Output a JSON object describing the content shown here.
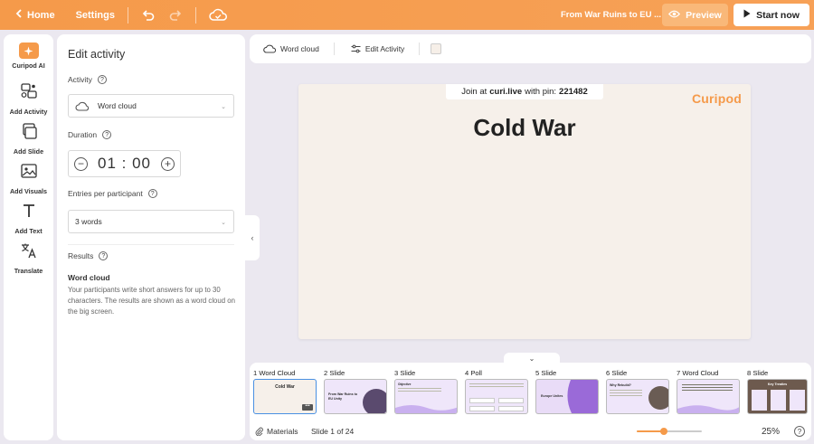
{
  "topbar": {
    "home_label": "Home",
    "settings_label": "Settings",
    "title": "From War Ruins to EU ...",
    "preview_label": "Preview",
    "start_label": "Start now"
  },
  "rail": [
    {
      "label": "Curipod AI",
      "icon": "sparkle-icon"
    },
    {
      "label": "Add Activity",
      "icon": "activity-icon"
    },
    {
      "label": "Add Slide",
      "icon": "slides-icon"
    },
    {
      "label": "Add Visuals",
      "icon": "image-icon"
    },
    {
      "label": "Add Text",
      "icon": "text-icon"
    },
    {
      "label": "Translate",
      "icon": "translate-icon"
    }
  ],
  "panel": {
    "title": "Edit activity",
    "activity_label": "Activity",
    "activity_value": "Word cloud",
    "duration_label": "Duration",
    "duration_minutes": "01",
    "duration_seconds": "00",
    "entries_label": "Entries per participant",
    "entries_value": "3 words",
    "results_label": "Results",
    "results_title": "Word cloud",
    "results_desc": "Your participants write short answers for up to 30 characters. The results are shown as a word cloud on the big screen."
  },
  "toolbar": {
    "wordcloud_label": "Word cloud",
    "edit_label": "Edit Activity"
  },
  "slide": {
    "join_prefix": "Join at",
    "join_site": "curi.live",
    "join_mid": "with pin:",
    "join_pin": "221482",
    "logo": "Curipod",
    "title": "Cold War"
  },
  "filmstrip": {
    "thumbs": [
      {
        "label": "1 Word Cloud",
        "caption": "Cold War",
        "style": "beige"
      },
      {
        "label": "2 Slide",
        "caption": "From War Ruins to EU Unity",
        "style": "lilac-image"
      },
      {
        "label": "3 Slide",
        "caption": "Objective",
        "style": "lilac-wave"
      },
      {
        "label": "4 Poll",
        "caption": "",
        "style": "lilac-poll"
      },
      {
        "label": "5 Slide",
        "caption": "Europe Unites",
        "style": "purple"
      },
      {
        "label": "6 Slide",
        "caption": "Why Rebuild?",
        "style": "lilac-image2"
      },
      {
        "label": "7 Word Cloud",
        "caption": "",
        "style": "lilac-text"
      },
      {
        "label": "8 Slide",
        "caption": "Key Treaties",
        "style": "photo"
      }
    ],
    "materials_label": "Materials",
    "slide_counter": "Slide 1 of 24",
    "zoom": "25%",
    "zoom_fraction": 0.42
  },
  "colors": {
    "accent": "#f59a4a",
    "lilac": "#e9dcf7",
    "purple": "#9a6ad8"
  }
}
